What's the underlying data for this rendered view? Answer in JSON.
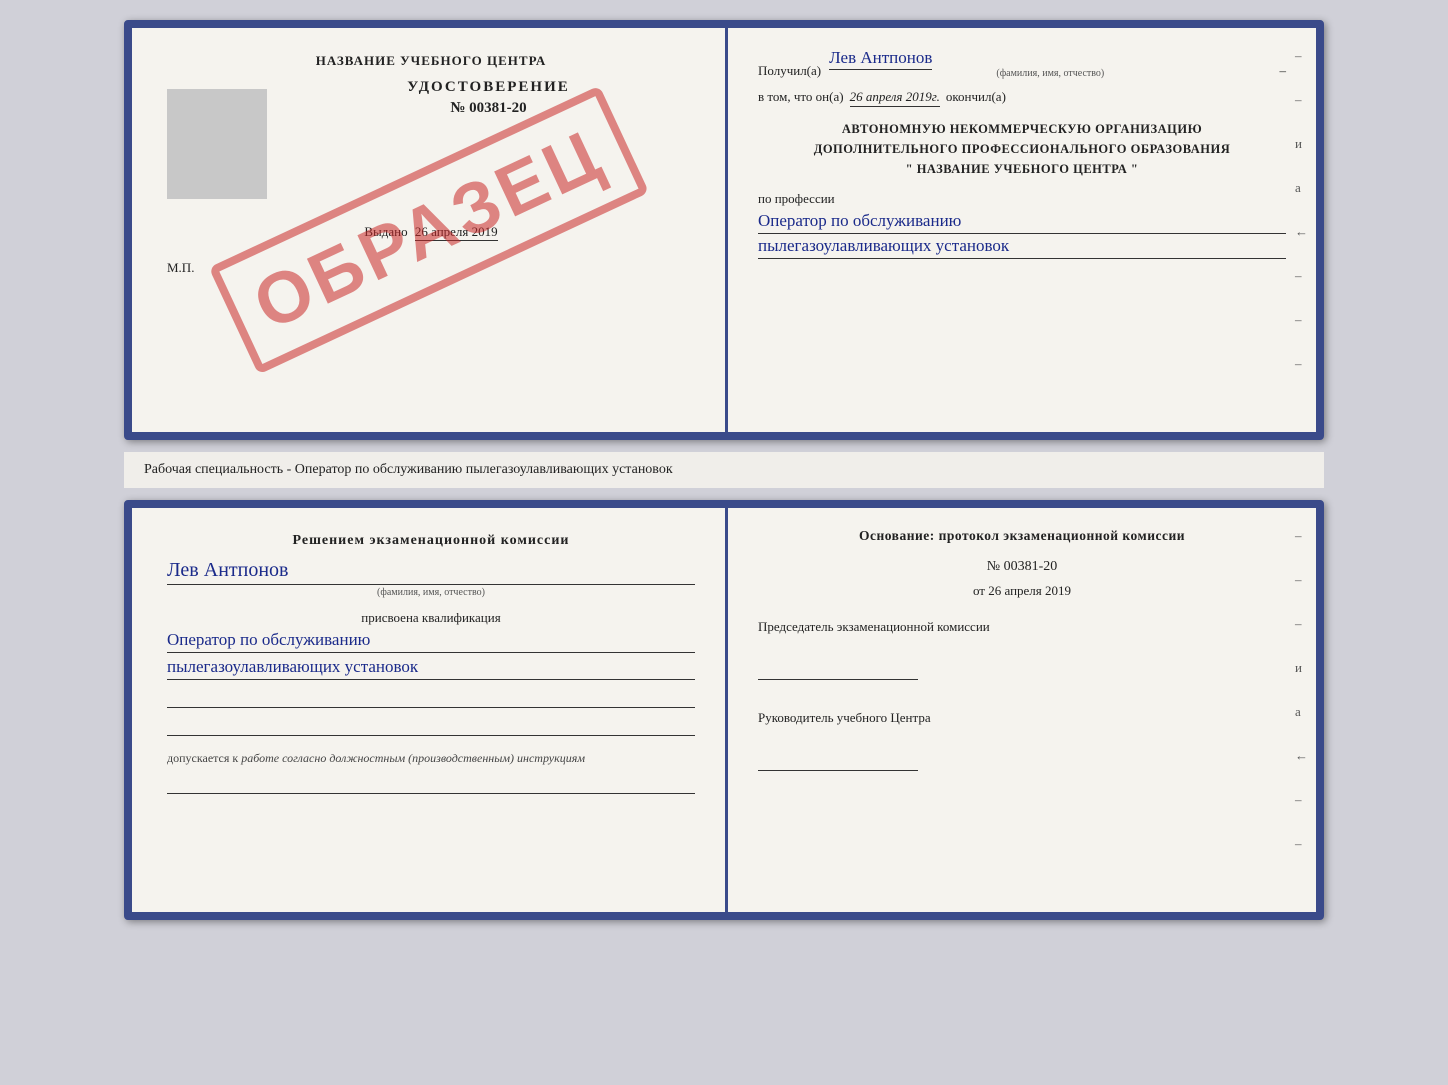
{
  "page": {
    "background": "#d0d0d8"
  },
  "top_book": {
    "left_page": {
      "title": "НАЗВАНИЕ УЧЕБНОГО ЦЕНТРА",
      "certificate_label": "УДОСТОВЕРЕНИЕ",
      "certificate_number": "№ 00381-20",
      "issued_label": "Выдано",
      "issued_date": "26 апреля 2019",
      "mp_label": "М.П.",
      "stamp_text": "ОБРАЗЕЦ"
    },
    "right_page": {
      "recipient_prefix": "Получил(а)",
      "recipient_name": "Лев Антпонов",
      "fio_hint": "(фамилия, имя, отчество)",
      "date_prefix": "в том, что он(а)",
      "date_value": "26 апреля 2019г.",
      "finished_label": "окончил(а)",
      "org_line1": "АВТОНОМНУЮ НЕКОММЕРЧЕСКУЮ ОРГАНИЗАЦИЮ",
      "org_line2": "ДОПОЛНИТЕЛЬНОГО ПРОФЕССИОНАЛЬНОГО ОБРАЗОВАНИЯ",
      "org_line3": "\"  НАЗВАНИЕ УЧЕБНОГО ЦЕНТРА  \"",
      "profession_label": "по профессии",
      "profession_line1": "Оператор по обслуживанию",
      "profession_line2": "пылегазоулавливающих установок",
      "dash1": "–",
      "dash2": "–",
      "dash3": "–",
      "dash4": "и",
      "dash5": "а",
      "dash6": "←",
      "dash7": "–",
      "dash8": "–",
      "dash9": "–"
    }
  },
  "middle_label": {
    "text": "Рабочая специальность - Оператор по обслуживанию пылегазоулавливающих установок"
  },
  "bottom_book": {
    "left_page": {
      "decision_heading": "Решением экзаменационной комиссии",
      "person_name": "Лев Антпонов",
      "fio_hint": "(фамилия, имя, отчество)",
      "assigned_label": "присвоена квалификация",
      "qual_line1": "Оператор по обслуживанию",
      "qual_line2": "пылегазоулавливающих установок",
      "admission_prefix": "допускается к",
      "admission_italic": "работе согласно должностным (производственным) инструкциям"
    },
    "right_page": {
      "basis_heading": "Основание: протокол экзаменационной комиссии",
      "protocol_number": "№  00381-20",
      "protocol_date_prefix": "от",
      "protocol_date": "26 апреля 2019",
      "chairman_role": "Председатель экзаменационной комиссии",
      "director_role": "Руководитель учебного Центра",
      "dash1": "–",
      "dash2": "–",
      "dash3": "–",
      "dash4": "и",
      "dash5": "а",
      "dash6": "←",
      "dash7": "–",
      "dash8": "–",
      "dash9": "–"
    }
  }
}
